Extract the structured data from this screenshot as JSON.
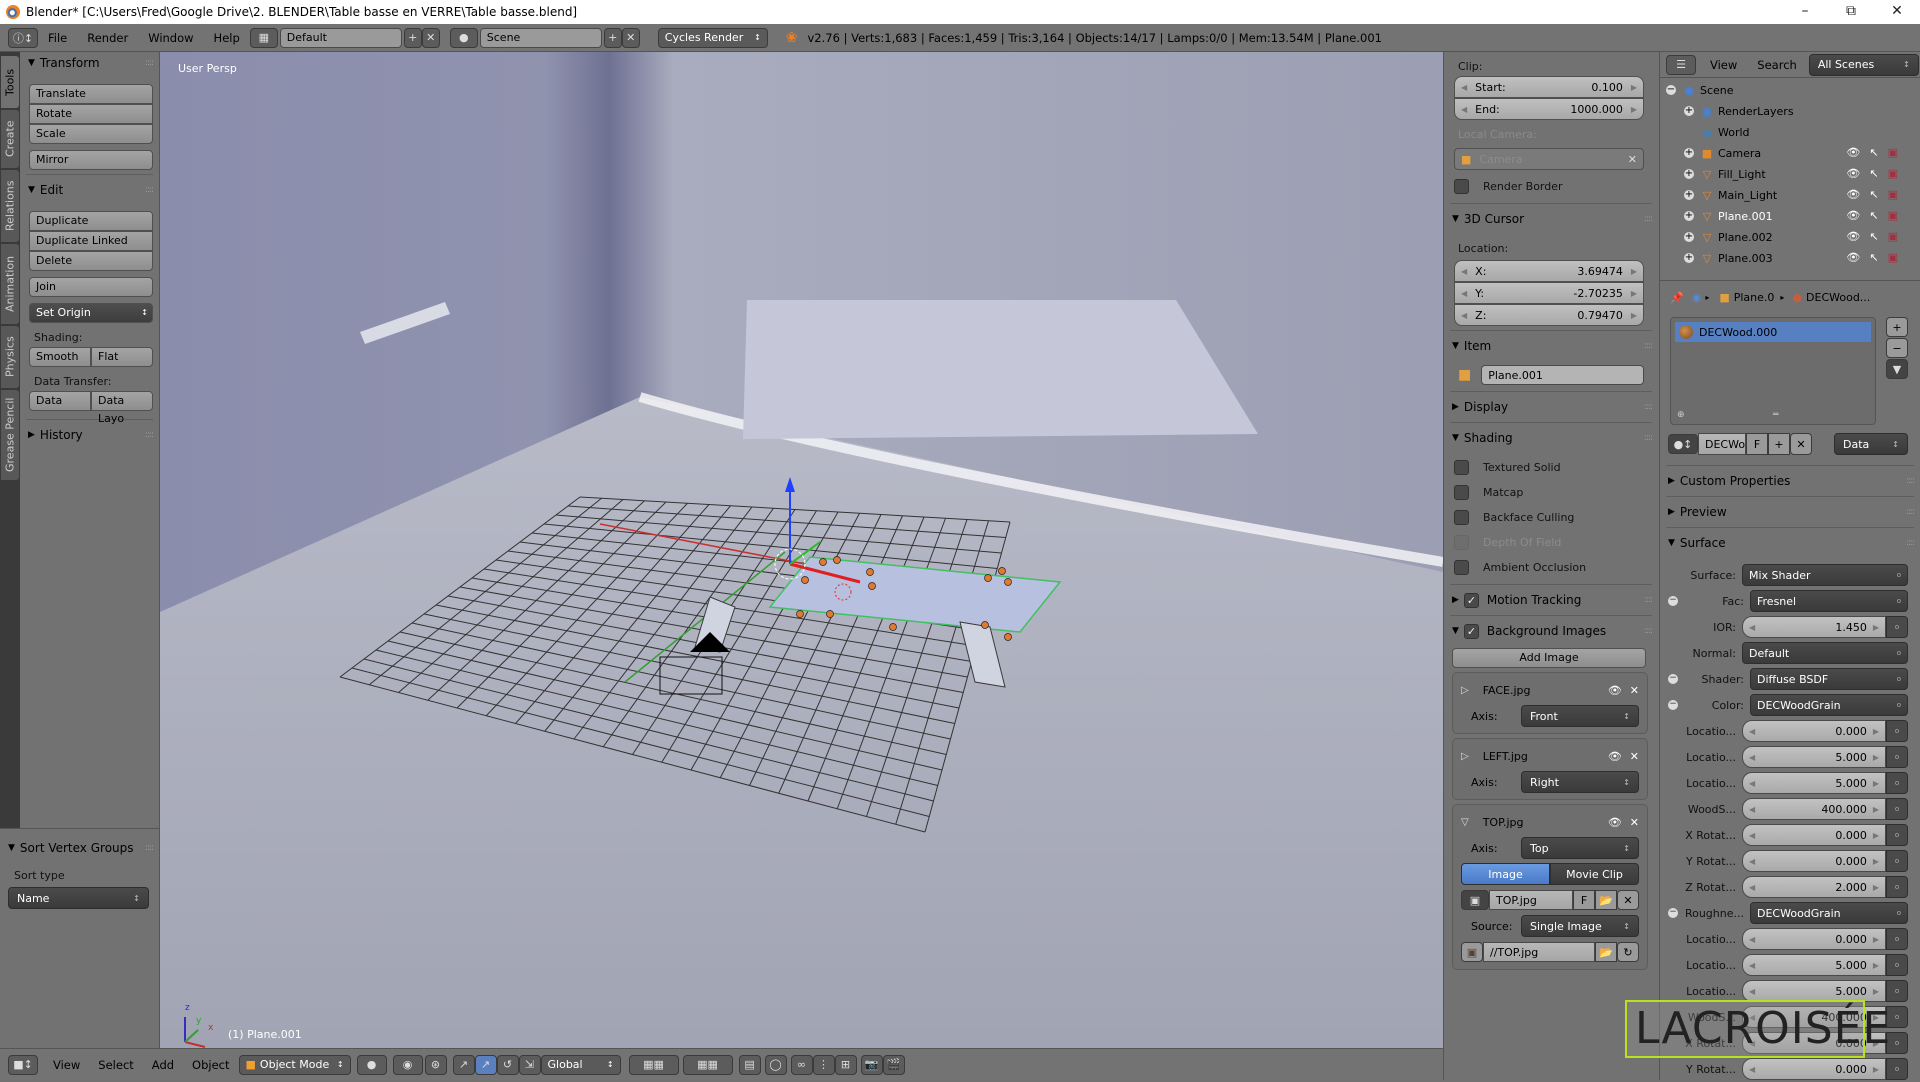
{
  "window": {
    "title": "Blender* [C:\\Users\\Fred\\Google Drive\\2. BLENDER\\Table basse en VERRE\\Table basse.blend]",
    "controls": [
      "minimize",
      "restore",
      "close"
    ]
  },
  "menubar": {
    "items": [
      "File",
      "Render",
      "Window",
      "Help"
    ],
    "screen_layout": "Default",
    "scene": "Scene",
    "render_engine": "Cycles Render",
    "stats": "v2.76 | Verts:1,683 | Faces:1,459 | Tris:3,164 | Objects:14/17 | Lamps:0/0 | Mem:13.54M | Plane.001"
  },
  "tool_tabs": [
    "Tools",
    "Create",
    "Relations",
    "Animation",
    "Physics",
    "Grease Pencil"
  ],
  "tool_shelf": {
    "transform": {
      "title": "Transform",
      "buttons": [
        "Translate",
        "Rotate",
        "Scale"
      ],
      "mirror": "Mirror"
    },
    "edit": {
      "title": "Edit",
      "buttons": [
        "Duplicate",
        "Duplicate Linked",
        "Delete"
      ],
      "join": "Join",
      "set_origin": "Set Origin"
    },
    "shading": {
      "label": "Shading:",
      "smooth": "Smooth",
      "flat": "Flat"
    },
    "data_transfer": {
      "label": "Data Transfer:",
      "data": "Data",
      "data_layout": "Data Layo"
    },
    "history": "History"
  },
  "sort_vertex_groups": {
    "title": "Sort Vertex Groups",
    "label": "Sort type",
    "value": "Name"
  },
  "viewport": {
    "view_label": "User Persp",
    "object_label": "(1) Plane.001",
    "axis_labels": {
      "x": "x",
      "y": "y",
      "z": "z"
    }
  },
  "bottom_header": {
    "menus": [
      "View",
      "Select",
      "Add",
      "Object"
    ],
    "mode": "Object Mode",
    "orientation": "Global"
  },
  "n_panel": {
    "clip": {
      "label": "Clip:",
      "start_label": "Start:",
      "start": "0.100",
      "end_label": "End:",
      "end": "1000.000"
    },
    "local_camera": {
      "label": "Local Camera:",
      "value": "Camera"
    },
    "render_border": "Render Border",
    "cursor": {
      "title": "3D Cursor",
      "location_label": "Location:",
      "x": "3.69474",
      "y": "-2.70235",
      "z": "0.79470"
    },
    "item": {
      "title": "Item",
      "name": "Plane.001"
    },
    "display": "Display",
    "shading": {
      "title": "Shading",
      "options": [
        {
          "label": "Textured Solid",
          "checked": false,
          "enabled": true
        },
        {
          "label": "Matcap",
          "checked": false,
          "enabled": true
        },
        {
          "label": "Backface Culling",
          "checked": false,
          "enabled": true
        },
        {
          "label": "Depth Of Field",
          "checked": false,
          "enabled": false
        },
        {
          "label": "Ambient Occlusion",
          "checked": false,
          "enabled": true
        }
      ]
    },
    "motion_tracking": "Motion Tracking",
    "background_images": {
      "title": "Background Images",
      "add_button": "Add Image",
      "axis_label": "Axis:",
      "images": [
        {
          "name": "FACE.jpg",
          "axis": "Front",
          "expanded": false
        },
        {
          "name": "LEFT.jpg",
          "axis": "Right",
          "expanded": false
        },
        {
          "name": "TOP.jpg",
          "axis": "Top",
          "expanded": true
        }
      ],
      "source_tabs": [
        "Image",
        "Movie Clip"
      ],
      "active_source_tab": "Image",
      "image_datablock": "TOP.jpg",
      "fake_user": "F",
      "source_label": "Source:",
      "source": "Single Image",
      "filepath": "//TOP.jpg"
    }
  },
  "outliner": {
    "menus": [
      "View",
      "Search"
    ],
    "filter": "All Scenes",
    "rows": [
      {
        "name": "Scene",
        "icon": "scene-icon",
        "level": 0,
        "selected": false
      },
      {
        "name": "RenderLayers",
        "icon": "renderlayers-icon",
        "level": 1,
        "selected": false
      },
      {
        "name": "World",
        "icon": "world-icon",
        "level": 1,
        "selected": false
      },
      {
        "name": "Camera",
        "icon": "camera-icon",
        "level": 1,
        "selected": false
      },
      {
        "name": "Fill_Light",
        "icon": "mesh-icon",
        "level": 1,
        "selected": false
      },
      {
        "name": "Main_Light",
        "icon": "mesh-icon",
        "level": 1,
        "selected": false
      },
      {
        "name": "Plane.001",
        "icon": "mesh-icon",
        "level": 1,
        "selected": true
      },
      {
        "name": "Plane.002",
        "icon": "mesh-icon",
        "level": 1,
        "selected": false
      },
      {
        "name": "Plane.003",
        "icon": "mesh-icon",
        "level": 1,
        "selected": false
      }
    ]
  },
  "properties": {
    "breadcrumb": [
      "Plane.0",
      "DECWood..."
    ],
    "material_slot": "DECWood.000",
    "material_name": "DECWo",
    "fake_user": "F",
    "link": "Data",
    "panels": [
      "Custom Properties",
      "Preview",
      "Surface"
    ],
    "surface": {
      "rows": [
        {
          "label": "Surface:",
          "type": "dropdown",
          "value": "Mix Shader",
          "socket": false
        },
        {
          "label": "Fac:",
          "type": "dropdown",
          "value": "Fresnel",
          "socket": true
        },
        {
          "label": "IOR:",
          "type": "number",
          "value": "1.450",
          "socket": false
        },
        {
          "label": "Normal:",
          "type": "dropdown",
          "value": "Default",
          "socket": false
        },
        {
          "label": "Shader:",
          "type": "dropdown",
          "value": "Diffuse BSDF",
          "socket": true
        },
        {
          "label": "Color:",
          "type": "dropdown",
          "value": "DECWoodGrain",
          "socket": true
        },
        {
          "label": "Locatio...",
          "type": "number",
          "value": "0.000",
          "socket": false
        },
        {
          "label": "Locatio...",
          "type": "number",
          "value": "5.000",
          "socket": false
        },
        {
          "label": "Locatio...",
          "type": "number",
          "value": "5.000",
          "socket": false
        },
        {
          "label": "WoodS...",
          "type": "number",
          "value": "400.000",
          "socket": false
        },
        {
          "label": "X Rotat...",
          "type": "number",
          "value": "0.000",
          "socket": false
        },
        {
          "label": "Y Rotat...",
          "type": "number",
          "value": "0.000",
          "socket": false
        },
        {
          "label": "Z Rotat...",
          "type": "number",
          "value": "2.000",
          "socket": false
        },
        {
          "label": "Roughne...",
          "type": "dropdown",
          "value": "DECWoodGrain",
          "socket": true
        },
        {
          "label": "Locatio...",
          "type": "number",
          "value": "0.000",
          "socket": false
        },
        {
          "label": "Locatio...",
          "type": "number",
          "value": "5.000",
          "socket": false
        },
        {
          "label": "Locatio...",
          "type": "number",
          "value": "5.000",
          "socket": false
        },
        {
          "label": "WoodS...",
          "type": "number",
          "value": "400.000",
          "socket": false
        },
        {
          "label": "X Rotat...",
          "type": "number",
          "value": "0.000",
          "socket": false
        },
        {
          "label": "Y Rotat...",
          "type": "number",
          "value": "0.000",
          "socket": false
        }
      ]
    }
  },
  "watermark": "LACROISÉE"
}
